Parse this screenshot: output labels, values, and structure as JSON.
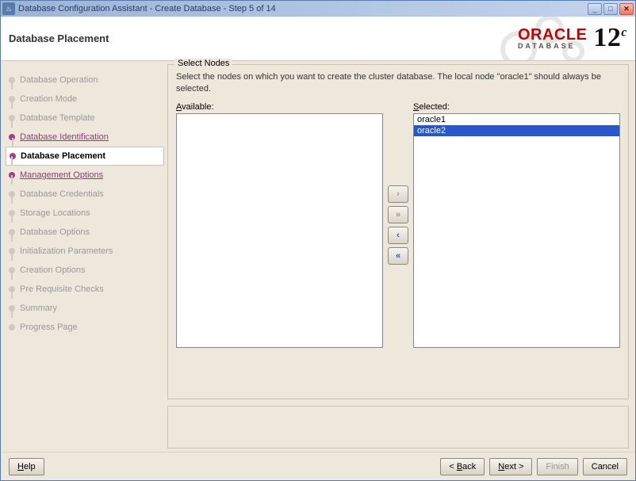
{
  "window": {
    "title": "Database Configuration Assistant - Create Database - Step 5 of 14"
  },
  "header": {
    "page_title": "Database Placement",
    "brand": "ORACLE",
    "brand_sub": "DATABASE",
    "version": "12",
    "version_suffix": "c"
  },
  "sidebar": {
    "steps": [
      {
        "label": "Database Operation",
        "state": "disabled"
      },
      {
        "label": "Creation Mode",
        "state": "disabled"
      },
      {
        "label": "Database Template",
        "state": "disabled"
      },
      {
        "label": "Database Identification",
        "state": "link"
      },
      {
        "label": "Database Placement",
        "state": "current"
      },
      {
        "label": "Management Options",
        "state": "link"
      },
      {
        "label": "Database Credentials",
        "state": "disabled"
      },
      {
        "label": "Storage Locations",
        "state": "disabled"
      },
      {
        "label": "Database Options",
        "state": "disabled"
      },
      {
        "label": "Initialization Parameters",
        "state": "disabled"
      },
      {
        "label": "Creation Options",
        "state": "disabled"
      },
      {
        "label": "Pre Requisite Checks",
        "state": "disabled"
      },
      {
        "label": "Summary",
        "state": "disabled"
      },
      {
        "label": "Progress Page",
        "state": "disabled"
      }
    ]
  },
  "content": {
    "group_title": "Select Nodes",
    "instruction": "Select the nodes on which you want to create the cluster database. The local node \"oracle1\" should always be selected.",
    "available_label": "Available:",
    "selected_label": "Selected:",
    "available_items": [],
    "selected_items": [
      {
        "text": "oracle1",
        "selected": false
      },
      {
        "text": "oracle2",
        "selected": true
      }
    ],
    "shuttle": {
      "add": "›",
      "add_all": "»",
      "remove": "‹",
      "remove_all": "«"
    }
  },
  "footer": {
    "help": "Help",
    "back": "< Back",
    "next": "Next >",
    "finish": "Finish",
    "cancel": "Cancel"
  }
}
